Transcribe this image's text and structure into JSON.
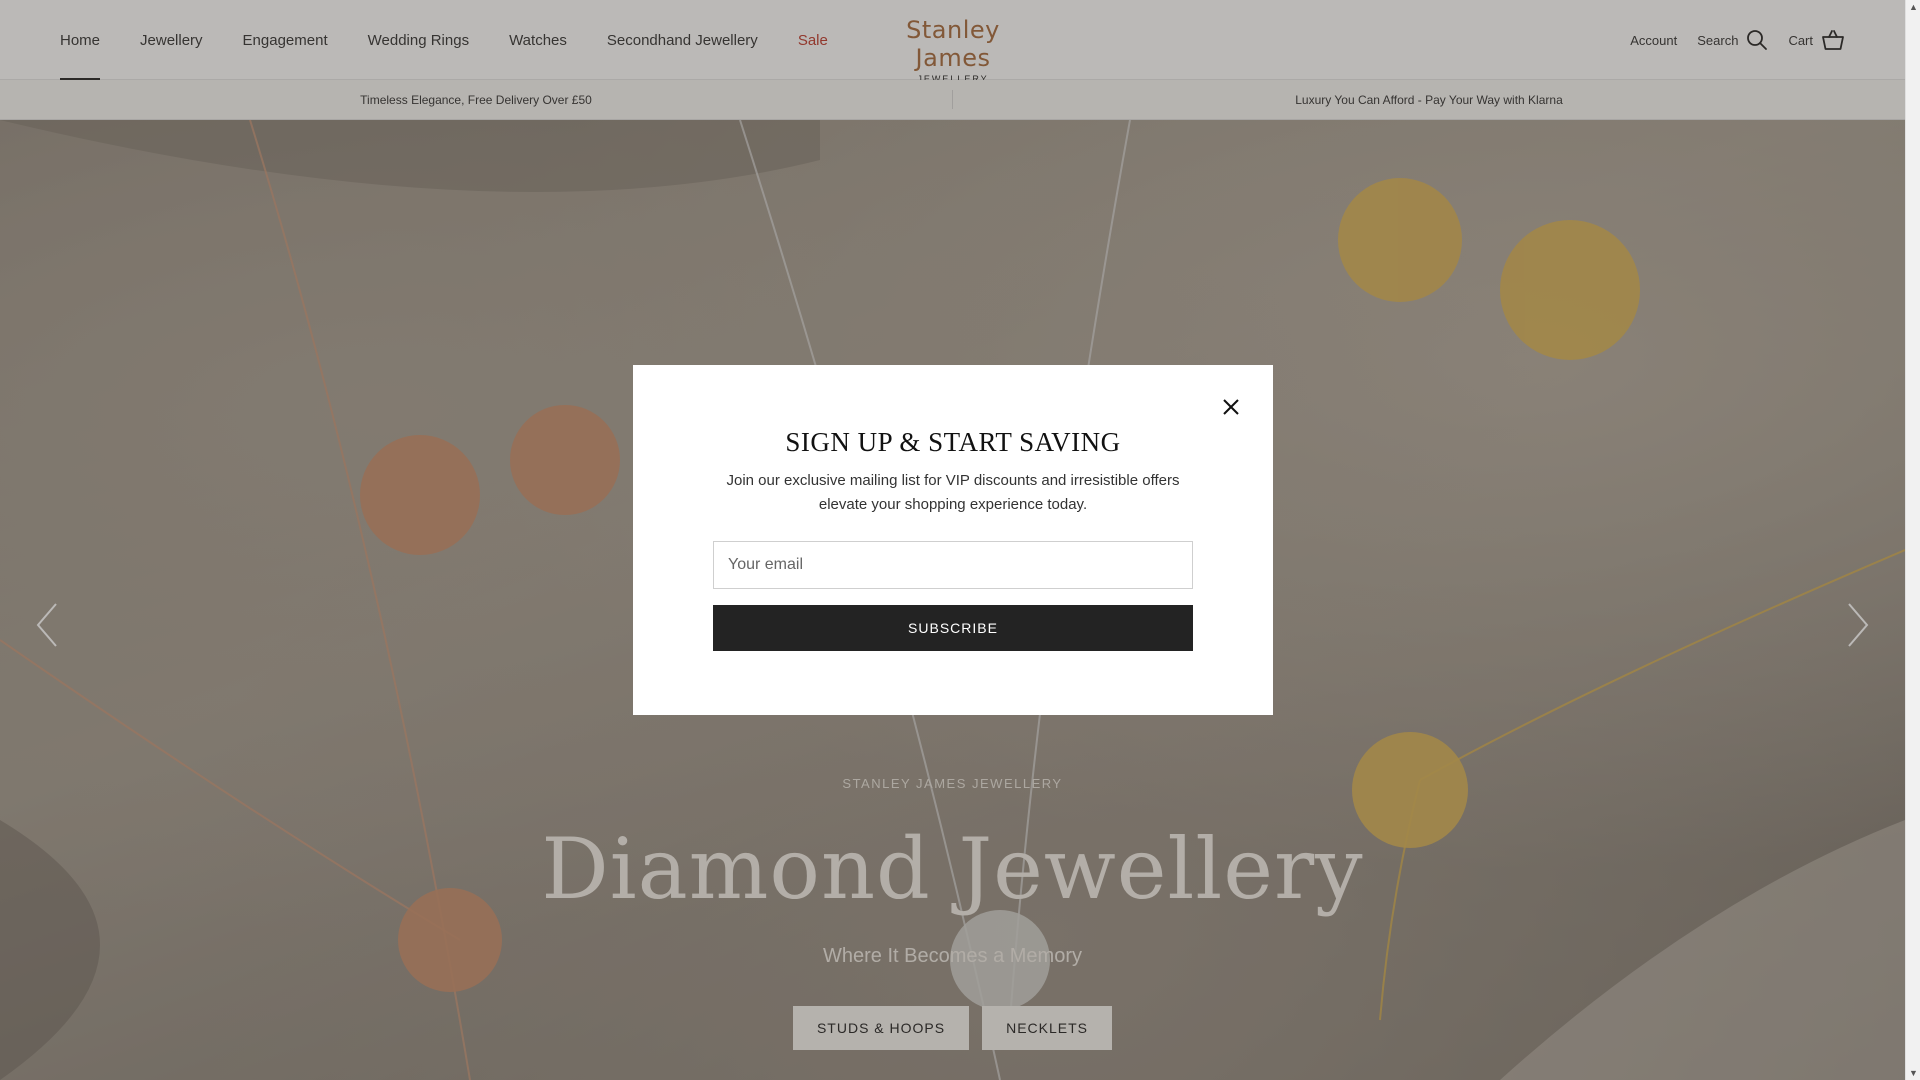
{
  "nav": {
    "items": [
      {
        "label": "Home"
      },
      {
        "label": "Jewellery"
      },
      {
        "label": "Engagement"
      },
      {
        "label": "Wedding Rings"
      },
      {
        "label": "Watches"
      },
      {
        "label": "Secondhand Jewellery"
      },
      {
        "label": "Sale"
      }
    ],
    "active": "Home"
  },
  "logo": {
    "main": "Stanley James",
    "sub": "JEWELLERY"
  },
  "header": {
    "account": "Account",
    "search": "Search",
    "cart": "Cart"
  },
  "announcement": {
    "left": "Timeless Elegance, Free Delivery Over £50",
    "right": "Luxury You Can Afford - Pay Your Way with Klarna"
  },
  "hero": {
    "eyebrow": "STANLEY JAMES JEWELLERY",
    "title": "Diamond Jewellery",
    "subtitle": "Where It Becomes a Memory",
    "buttons": [
      {
        "label": "STUDS & HOOPS"
      },
      {
        "label": "NECKLETS"
      }
    ]
  },
  "modal": {
    "title": "SIGN UP & START SAVING",
    "text": "Join our exclusive mailing list for VIP discounts and irresistible offers elevate your shopping experience today.",
    "email_placeholder": "Your email",
    "subscribe": "SUBSCRIBE"
  },
  "colors": {
    "logo": "#a86b3c",
    "sale": "#c0392b",
    "button_dark": "#232323"
  },
  "icons": {
    "search": "search-icon",
    "cart": "cart-icon",
    "close": "close-icon",
    "prev": "chevron-left-icon",
    "next": "chevron-right-icon"
  }
}
